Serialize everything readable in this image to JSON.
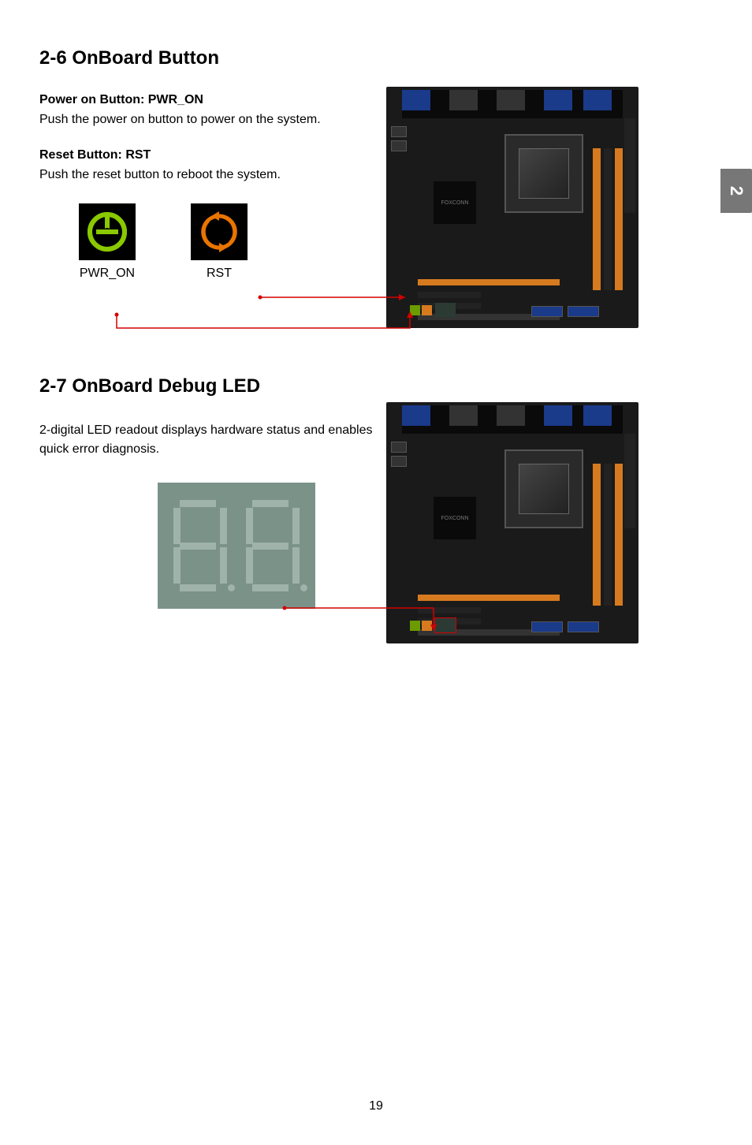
{
  "page": {
    "number": "19",
    "side_tab": "2"
  },
  "section1": {
    "heading": "2-6 OnBoard Button",
    "sub1": "Power on Button: PWR_ON",
    "desc1": "Push the power on button to power on the system.",
    "sub2": "Reset Button: RST",
    "desc2": "Push the reset button to reboot the system.",
    "btn1_label": "PWR_ON",
    "btn2_label": "RST"
  },
  "section2": {
    "heading": "2-7 OnBoard Debug LED",
    "desc": "2-digital LED readout displays hardware status and enables quick error diagnosis."
  }
}
